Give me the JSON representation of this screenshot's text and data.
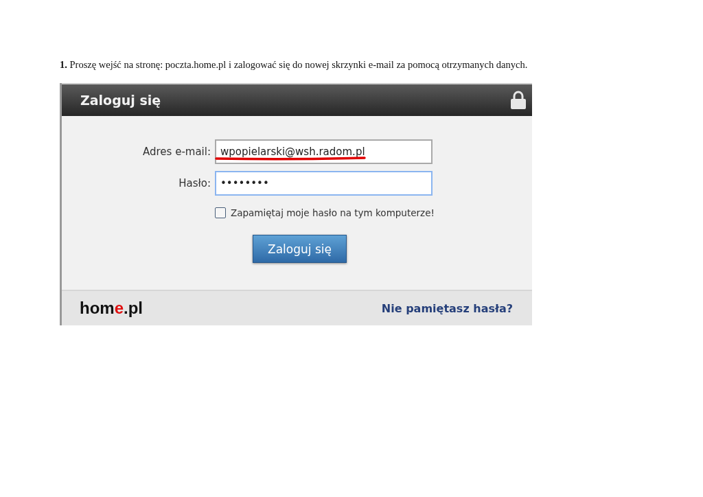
{
  "instruction": "**1.** Proszę wejść na stronę: poczta.home.pl i zalogować się do nowej skrzynki e-mail za pomocą otrzymanych danych.",
  "login": {
    "title": "Zaloguj się",
    "email": {
      "label": "Adres e-mail:",
      "value": "wpopielarski@wsh.radom.pl",
      "underlined": true
    },
    "password": {
      "label": "Hasło:",
      "value": "••••••••",
      "focused": true
    },
    "remember": {
      "label": "Zapamiętaj moje hasło na tym komputerze!",
      "checked": false
    },
    "submit": "Zaloguj się",
    "logo": [
      {
        "text": "hom",
        "accent": false
      },
      {
        "text": "e",
        "accent": true
      },
      {
        "text": ".pl",
        "accent": false
      }
    ],
    "forgot_link": "Nie pamiętasz hasła?"
  }
}
